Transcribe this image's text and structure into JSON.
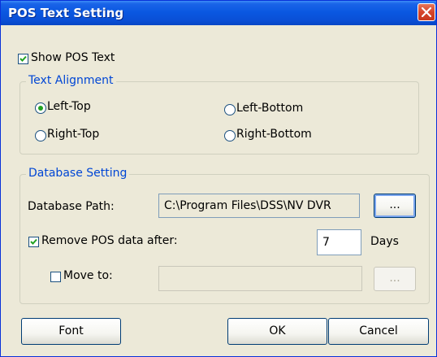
{
  "window": {
    "title": "POS Text Setting"
  },
  "show_pos_text": {
    "label": "Show POS Text",
    "checked": true
  },
  "text_alignment": {
    "title": "Text Alignment",
    "options": [
      {
        "label": "Left-Top",
        "selected": true
      },
      {
        "label": "Left-Bottom",
        "selected": false
      },
      {
        "label": "Right-Top",
        "selected": false
      },
      {
        "label": "Right-Bottom",
        "selected": false
      }
    ]
  },
  "database_setting": {
    "title": "Database Setting",
    "path_label": "Database Path:",
    "path_value": "C:\\Program Files\\DSS\\NV DVR",
    "browse_label": "...",
    "remove": {
      "label": "Remove POS data after:",
      "checked": true,
      "days_value": "7",
      "days_unit": "Days"
    },
    "move_to": {
      "label": "Move to:",
      "checked": false,
      "value": "",
      "browse_label": "..."
    }
  },
  "buttons": {
    "font": "Font",
    "ok": "OK",
    "cancel": "Cancel"
  },
  "colors": {
    "titlebar": "#0a58e1",
    "group_title": "#0046d5",
    "check_mark": "#21a121",
    "close_button": "#d6452a"
  },
  "icons": {
    "close": "close-icon",
    "check": "check-icon",
    "radio": "radio-dot-icon"
  }
}
